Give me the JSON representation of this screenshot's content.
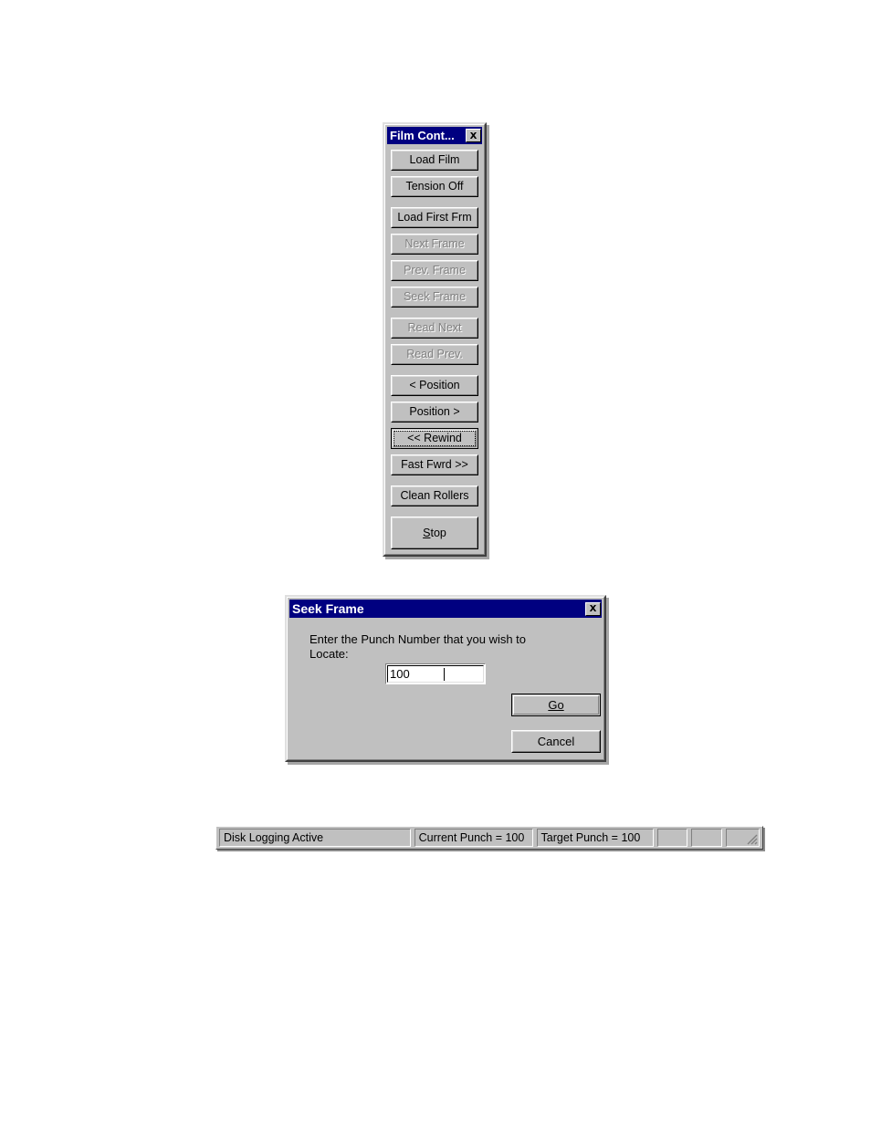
{
  "film_control": {
    "title": "Film Cont...",
    "close_icon": "close-icon",
    "buttons": [
      {
        "label": "Load Film",
        "disabled": false,
        "gap_after": false,
        "focused": false,
        "tall": false
      },
      {
        "label": "Tension Off",
        "disabled": false,
        "gap_after": true,
        "focused": false,
        "tall": false
      },
      {
        "label": "Load First Frm",
        "disabled": false,
        "gap_after": false,
        "focused": false,
        "tall": false
      },
      {
        "label": "Next Frame",
        "disabled": true,
        "gap_after": false,
        "focused": false,
        "tall": false
      },
      {
        "label": "Prev. Frame",
        "disabled": true,
        "gap_after": false,
        "focused": false,
        "tall": false
      },
      {
        "label": "Seek Frame",
        "disabled": true,
        "gap_after": true,
        "focused": false,
        "tall": false
      },
      {
        "label": "Read Next",
        "disabled": true,
        "gap_after": false,
        "focused": false,
        "tall": false
      },
      {
        "label": "Read Prev.",
        "disabled": true,
        "gap_after": true,
        "focused": false,
        "tall": false
      },
      {
        "label": "< Position",
        "disabled": false,
        "gap_after": false,
        "focused": false,
        "tall": false
      },
      {
        "label": "Position >",
        "disabled": false,
        "gap_after": false,
        "focused": false,
        "tall": false
      },
      {
        "label": "<< Rewind",
        "disabled": false,
        "gap_after": false,
        "focused": true,
        "tall": false
      },
      {
        "label": "Fast Fwrd >>",
        "disabled": false,
        "gap_after": true,
        "focused": false,
        "tall": false
      },
      {
        "label": "Clean Rollers",
        "disabled": false,
        "gap_after": true,
        "focused": false,
        "tall": false
      },
      {
        "label": "Stop",
        "disabled": false,
        "gap_after": false,
        "focused": false,
        "tall": true,
        "accel": "S"
      }
    ]
  },
  "seek_dialog": {
    "title": "Seek Frame",
    "close_icon": "close-icon",
    "prompt": "Enter the Punch Number that you wish to Locate:",
    "input": {
      "value": "100",
      "placeholder": ""
    },
    "go_button": {
      "label": "Go",
      "accel": "G",
      "is_default": true
    },
    "cancel_button": {
      "label": "Cancel",
      "is_default": false
    }
  },
  "status_bar": {
    "panes": [
      {
        "text": "Disk Logging Active"
      },
      {
        "text": "Current Punch = 100"
      },
      {
        "text": "Target Punch = 100"
      },
      {
        "text": ""
      },
      {
        "text": ""
      },
      {
        "text": ""
      }
    ],
    "grip_icon": "resize-grip-icon"
  },
  "colors": {
    "face": "#c0c0c0",
    "titlebar_active": "#000080",
    "titlebar_text": "#ffffff",
    "text": "#000000",
    "text_disabled": "#808080",
    "field_bg": "#ffffff"
  }
}
